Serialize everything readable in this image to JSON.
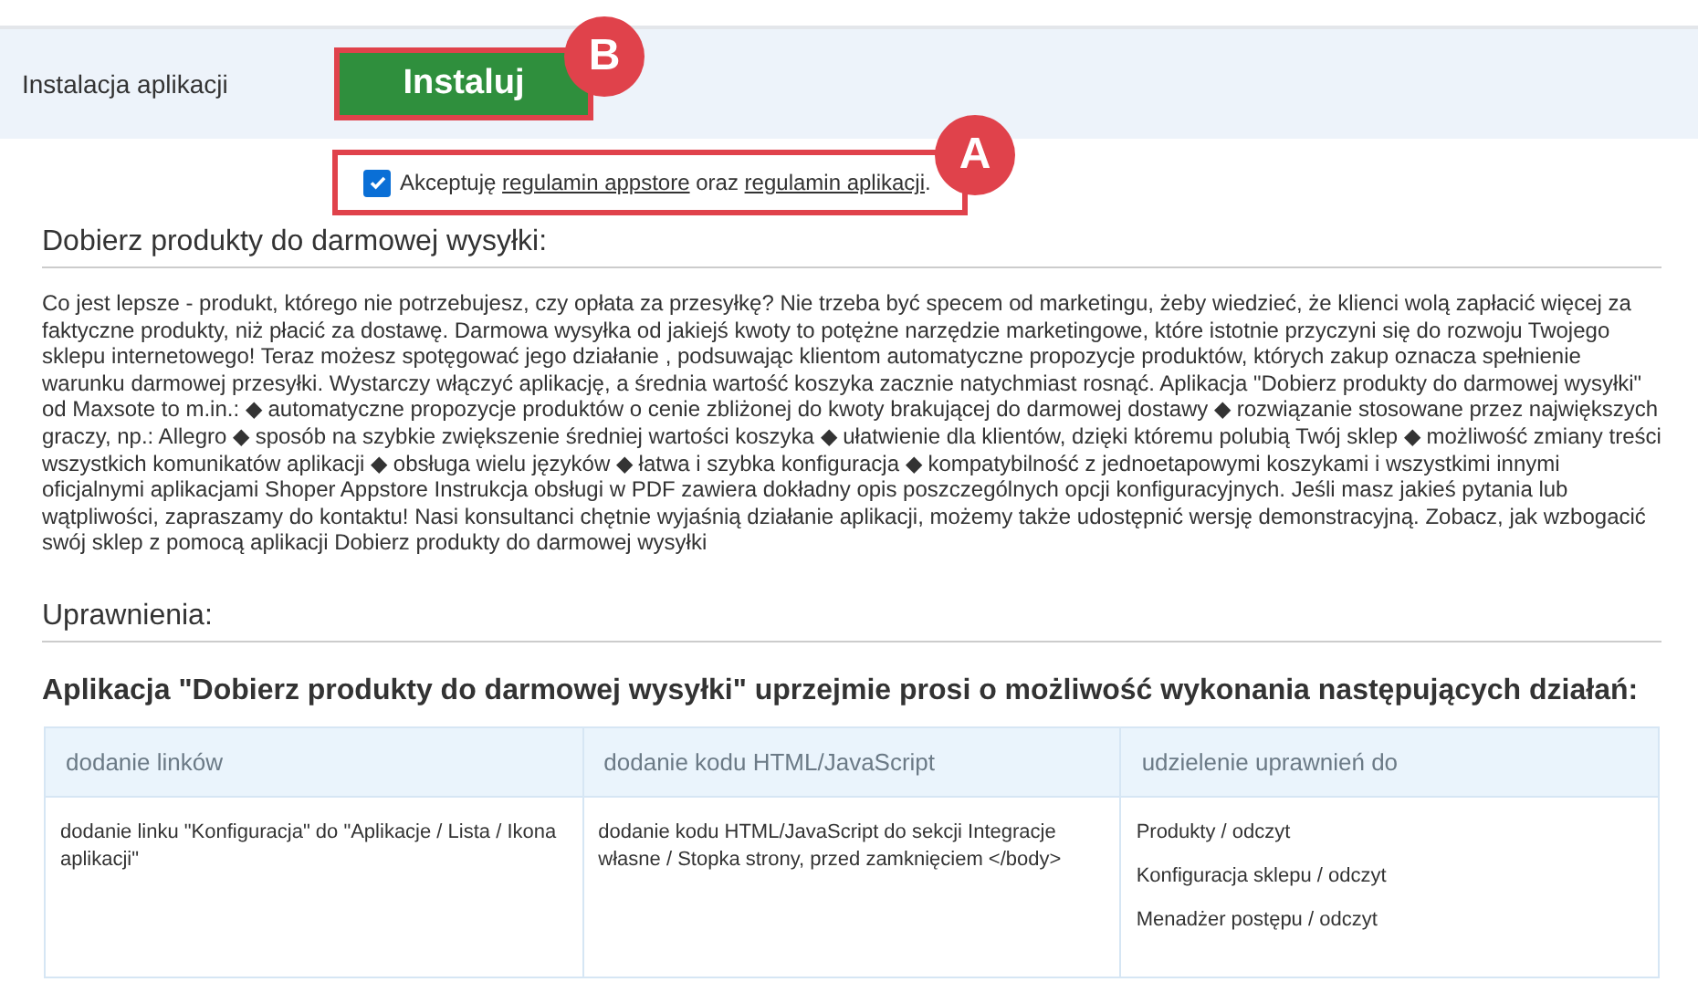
{
  "install": {
    "label": "Instalacja aplikacji",
    "button": "Instaluj",
    "marker": "B"
  },
  "terms": {
    "checked": true,
    "marker": "A",
    "parts": [
      {
        "kind": "text",
        "text": "Akceptuję "
      },
      {
        "kind": "link",
        "text": "regulamin appstore"
      },
      {
        "kind": "text",
        "text": " oraz "
      },
      {
        "kind": "link",
        "text": "regulamin aplikacji"
      },
      {
        "kind": "text",
        "text": "."
      }
    ]
  },
  "description": {
    "title": "Dobierz produkty do darmowej wysyłki:",
    "text": "Co jest lepsze - produkt, którego nie potrzebujesz, czy opłata za przesyłkę? Nie trzeba być specem od marketingu, żeby wiedzieć, że klienci wolą zapłacić więcej za faktyczne produkty, niż płacić za dostawę. Darmowa wysyłka od jakiejś kwoty to potężne narzędzie marketingowe, które istotnie przyczyni się do rozwoju Twojego sklepu internetowego! Teraz możesz spotęgować jego działanie , podsuwając klientom automatyczne propozycje produktów, których zakup oznacza spełnienie warunku darmowej przesyłki. Wystarczy włączyć aplikację, a średnia wartość koszyka zacznie natychmiast rosnąć. Aplikacja \"Dobierz produkty do darmowej wysyłki\" od Maxsote to m.in.: ◆ automatyczne propozycje produktów o cenie zbliżonej do kwoty brakującej do darmowej dostawy ◆ rozwiązanie stosowane przez największych graczy, np.: Allegro ◆ sposób na szybkie zwiększenie średniej wartości koszyka ◆ ułatwienie dla klientów, dzięki któremu polubią Twój sklep ◆ możliwość zmiany treści wszystkich komunikatów aplikacji ◆ obsługa wielu języków ◆ łatwa i szybka konfiguracja ◆ kompatybilność z jednoetapowymi koszykami i wszystkimi innymi oficjalnymi aplikacjami Shoper Appstore Instrukcja obsługi w PDF zawiera dokładny opis poszczególnych opcji konfiguracyjnych. Jeśli masz jakieś pytania lub wątpliwości, zapraszamy do kontaktu! Nasi konsultanci chętnie wyjaśnią działanie aplikacji, możemy także udostępnić wersję demonstracyjną. Zobacz, jak wzbogacić swój sklep z pomocą aplikacji Dobierz produkty do darmowej wysyłki"
  },
  "permissions": {
    "title": "Uprawnienia:",
    "intro": "Aplikacja \"Dobierz produkty do darmowej wysyłki\" uprzejmie prosi o możliwość wykonania następujących działań:",
    "columns": [
      {
        "header": "dodanie linków",
        "items": [
          "dodanie linku \"Konfiguracja\" do \"Aplikacje / Lista / Ikona aplikacji\""
        ]
      },
      {
        "header": "dodanie kodu HTML/JavaScript",
        "items": [
          "dodanie kodu HTML/JavaScript do sekcji Integracje własne / Stopka strony, przed zamknięciem </body>"
        ]
      },
      {
        "header": "udzielenie uprawnień do",
        "items": [
          "Produkty / odczyt",
          "Konfiguracja sklepu / odczyt",
          "Menadżer postępu / odczyt"
        ]
      }
    ]
  }
}
